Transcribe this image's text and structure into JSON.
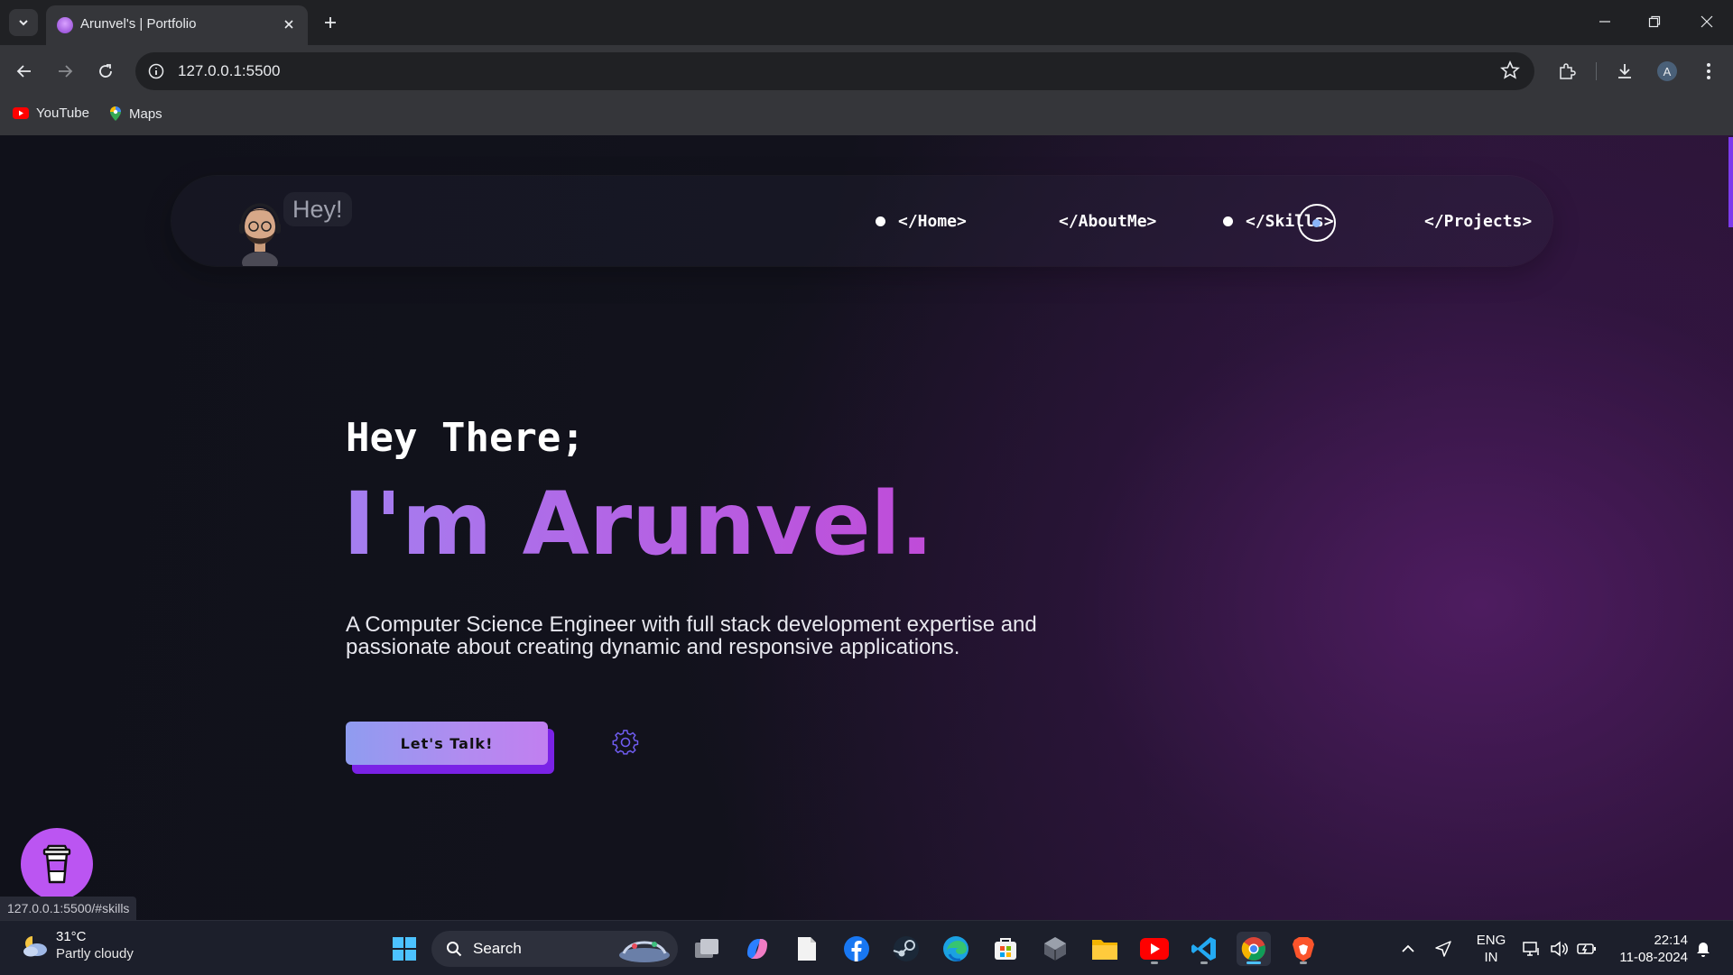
{
  "browser": {
    "tab_title": "Arunvel's | Portfolio",
    "url": "127.0.0.1:5500",
    "profile_initial": "A",
    "bookmarks": [
      {
        "label": "YouTube",
        "icon": "youtube-icon"
      },
      {
        "label": "Maps",
        "icon": "maps-icon"
      }
    ],
    "status_url": "127.0.0.1:5500/#skills"
  },
  "navbar": {
    "greeting": "Hey!",
    "links": [
      {
        "label": "</Home>",
        "active_dot": true
      },
      {
        "label": "</AboutMe>",
        "active_dot": false
      },
      {
        "label": "</Skills>",
        "active_dot": true
      },
      {
        "label": "</Projects>",
        "active_dot": false
      }
    ]
  },
  "hero": {
    "subtitle": "Hey There;",
    "name": "I'm Arunvel.",
    "description": "A Computer Science Engineer with full stack development expertise and passionate about creating dynamic and responsive applications.",
    "cta_label": "Let's Talk!"
  },
  "taskbar": {
    "weather_temp": "31°C",
    "weather_desc": "Partly cloudy",
    "search_label": "Search",
    "language": "ENG",
    "region": "IN",
    "time": "22:14",
    "date": "11-08-2024"
  },
  "colors": {
    "accent_purple": "#b266e6",
    "cta_shadow": "#7a22e6",
    "coffee_button": "#bb55f2",
    "page_bg": "#10111a"
  }
}
